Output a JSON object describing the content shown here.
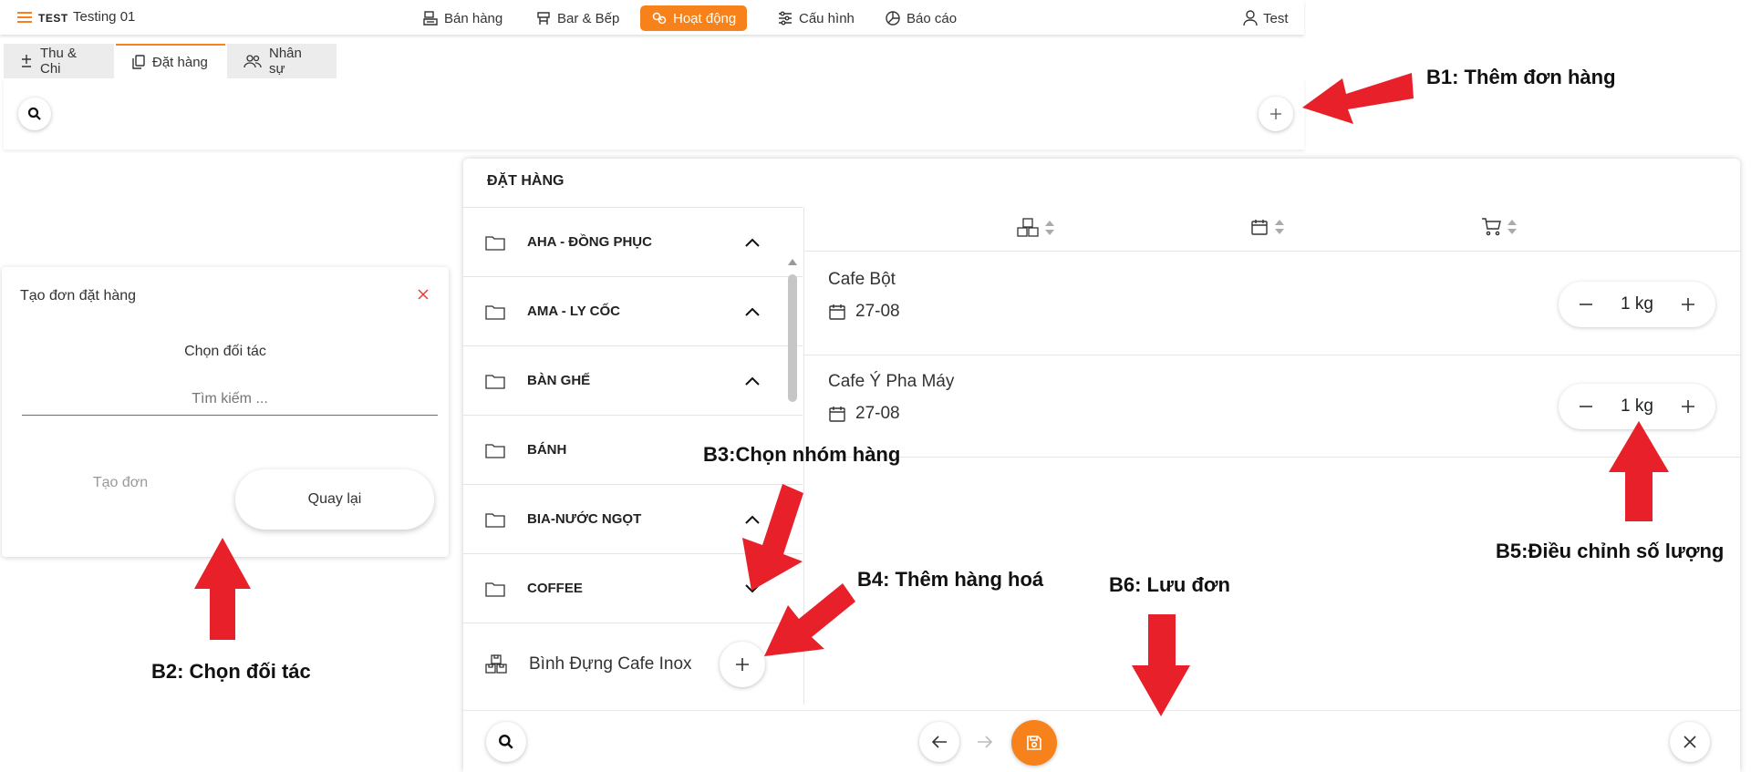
{
  "topbar": {
    "brand_name": "TEST",
    "store_name": "Testing 01",
    "nav": [
      {
        "label": "Bán hàng",
        "icon": "pos-icon"
      },
      {
        "label": "Bar & Bếp",
        "icon": "kitchen-icon"
      },
      {
        "label": "Hoạt động",
        "icon": "activity-icon",
        "active": true
      },
      {
        "label": "Cấu hình",
        "icon": "sliders-icon"
      },
      {
        "label": "Báo cáo",
        "icon": "pie-chart-icon"
      }
    ],
    "user_name": "Test",
    "accent_color": "#f7821b"
  },
  "tabs": [
    {
      "label": "Thu & Chi",
      "icon": "plus-minus-icon"
    },
    {
      "label": "Đặt hàng",
      "icon": "copy-icon",
      "active": true
    },
    {
      "label": "Nhân sự",
      "icon": "users-icon"
    }
  ],
  "dialog": {
    "title": "Tạo đơn đặt hàng",
    "partner_label": "Chọn đối tác",
    "search_placeholder": "Tìm kiếm ...",
    "create_label": "Tạo đơn",
    "back_label": "Quay lại"
  },
  "order_panel": {
    "title": "ĐẶT HÀNG",
    "categories": [
      {
        "label": "AHA - ĐỒNG PHỤC",
        "expanded": false
      },
      {
        "label": "AMA - LY CỐC",
        "expanded": false
      },
      {
        "label": "BÀN GHẾ",
        "expanded": false
      },
      {
        "label": "BÁNH",
        "expanded": false
      },
      {
        "label": "BIA-NƯỚC NGỌT",
        "expanded": false
      },
      {
        "label": "COFFEE",
        "expanded": true
      }
    ],
    "category_item": {
      "label": "Bình Đựng Cafe Inox"
    },
    "cart_items": [
      {
        "name": "Cafe Bột",
        "date": "27-08",
        "quantity": "1 kg"
      },
      {
        "name": "Cafe Ý Pha Máy",
        "date": "27-08",
        "quantity": "1 kg"
      }
    ]
  },
  "annotations": {
    "b1": "B1: Thêm đơn hàng",
    "b2": "B2: Chọn đối tác",
    "b3": "B3:Chọn nhóm hàng",
    "b4": "B4: Thêm hàng hoá",
    "b5": "B5:Điều chỉnh số lượng",
    "b6": "B6: Lưu đơn",
    "arrow_color": "#e8202a"
  }
}
